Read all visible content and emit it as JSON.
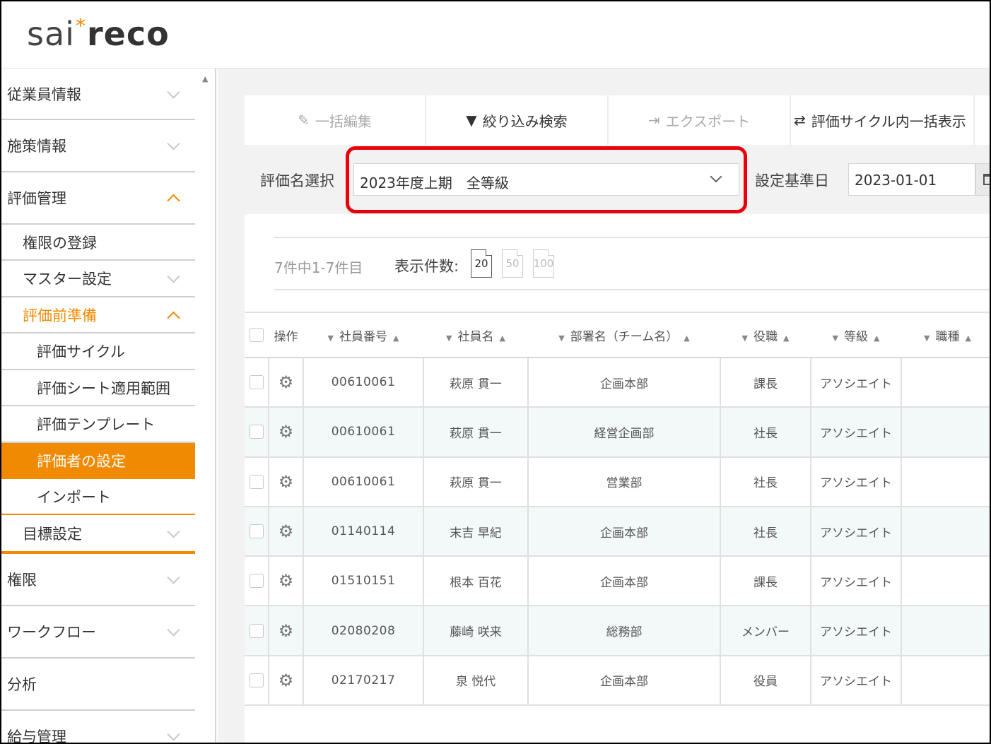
{
  "logo": {
    "part1": "sai",
    "star": "*",
    "part2": "reco"
  },
  "sidebar": {
    "items": [
      {
        "label": "従業員情報"
      },
      {
        "label": "施策情報"
      },
      {
        "label": "評価管理"
      },
      {
        "label": "権限の登録"
      },
      {
        "label": "マスター設定"
      },
      {
        "label": "評価前準備"
      },
      {
        "label": "評価サイクル"
      },
      {
        "label": "評価シート適用範囲"
      },
      {
        "label": "評価テンプレート"
      },
      {
        "label": "評価者の設定"
      },
      {
        "label": "インポート"
      },
      {
        "label": "目標設定"
      },
      {
        "label": "権限"
      },
      {
        "label": "ワークフロー"
      },
      {
        "label": "分析"
      },
      {
        "label": "給与管理"
      }
    ],
    "accent_color": "#f08a00"
  },
  "toolbar": {
    "bulk_edit": "一括編集",
    "filter_search": "絞り込み検索",
    "export": "エクスポート",
    "cycle_bulk_view": "評価サイクル内一括表示"
  },
  "filter": {
    "eval_name_label": "評価名選択",
    "eval_name_value": "2023年度上期　全等級",
    "base_date_label": "設定基準日",
    "base_date_value": "2023-01-01"
  },
  "pager": {
    "count_text": "7件中1-7件目",
    "per_page_label": "表示件数:",
    "options": [
      "20",
      "50",
      "100"
    ],
    "selected": "20"
  },
  "table": {
    "headers": [
      "操作",
      "社員番号",
      "社員名",
      "部署名（チーム名）",
      "役職",
      "等級",
      "職種"
    ],
    "rows": [
      [
        "00610061",
        "萩原 貫一",
        "企画本部",
        "課長",
        "アソシエイト",
        ""
      ],
      [
        "00610061",
        "萩原 貫一",
        "経営企画部",
        "社長",
        "アソシエイト",
        ""
      ],
      [
        "00610061",
        "萩原 貫一",
        "営業部",
        "社長",
        "アソシエイト",
        ""
      ],
      [
        "01140114",
        "末吉 早紀",
        "企画本部",
        "社長",
        "アソシエイト",
        ""
      ],
      [
        "01510151",
        "根本 百花",
        "企画本部",
        "課長",
        "アソシエイト",
        ""
      ],
      [
        "02080208",
        "藤崎 咲来",
        "総務部",
        "メンバー",
        "アソシエイト",
        ""
      ],
      [
        "02170217",
        "泉 悦代",
        "企画本部",
        "役員",
        "アソシエイト",
        ""
      ]
    ]
  },
  "highlight_color": "#e8000b"
}
